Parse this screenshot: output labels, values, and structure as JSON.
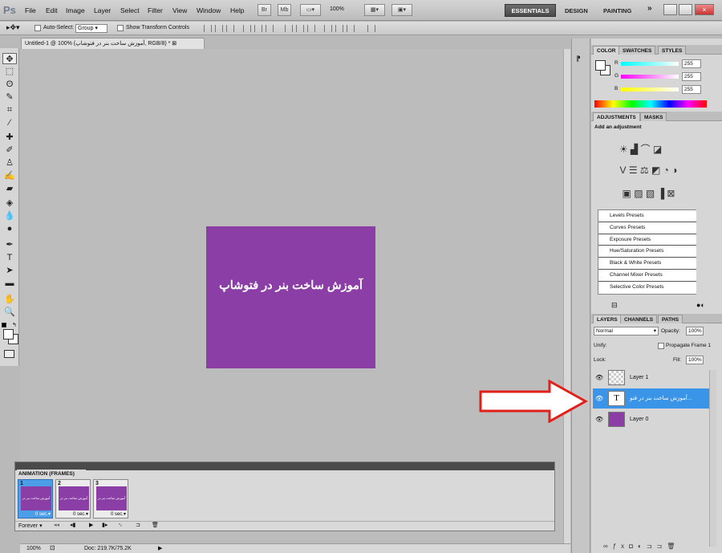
{
  "menubar": {
    "logo": "Ps",
    "items": [
      "File",
      "Edit",
      "Image",
      "Layer",
      "Select",
      "Filter",
      "View",
      "Window",
      "Help"
    ],
    "zoom": "100%",
    "workspaces": [
      "ESSENTIALS",
      "DESIGN",
      "PAINTING"
    ],
    "more": "»"
  },
  "options": {
    "auto_select_label": "Auto-Select:",
    "auto_select_value": "Group",
    "show_transform_label": "Show Transform Controls"
  },
  "document": {
    "tab_title": "Untitled-1 @ 100% (آموزش ساخت بنر در فتوشاپ, RGB/8) *",
    "artwork_text": "آموزش ساخت بنر در فتوشاپ",
    "artwork_color": "#8b3fa6"
  },
  "status": {
    "zoom": "100%",
    "doc": "Doc: 219.7K/75.2K"
  },
  "animation": {
    "title": "ANIMATION (FRAMES)",
    "frames": [
      {
        "num": "1",
        "delay": "0 sec.▾",
        "thumb": "آموزش ساخت بنر در فتوشاپ"
      },
      {
        "num": "2",
        "delay": "0 sec.▾",
        "thumb": "آموزش ساخت بنر در فتوشاپ"
      },
      {
        "num": "3",
        "delay": "0 sec.▾",
        "thumb": "آموزش ساخت بنر در فتوشاپ"
      }
    ],
    "loop": "Forever"
  },
  "color_panel": {
    "tabs": [
      "COLOR",
      "SWATCHES",
      "STYLES"
    ],
    "r_label": "R",
    "g_label": "G",
    "b_label": "B",
    "r": "255",
    "g": "255",
    "b": "255"
  },
  "adjustments": {
    "tabs": [
      "ADJUSTMENTS",
      "MASKS"
    ],
    "hint": "Add an adjustment",
    "presets": [
      "Levels Presets",
      "Curves Presets",
      "Exposure Presets",
      "Hue/Saturation Presets",
      "Black & White Presets",
      "Channel Mixer Presets",
      "Selective Color Presets"
    ]
  },
  "layers": {
    "tabs": [
      "LAYERS",
      "CHANNELS",
      "PATHS"
    ],
    "blend_mode": "Normal",
    "opacity_label": "Opacity:",
    "opacity": "100%",
    "unify_label": "Unify:",
    "propagate_label": "Propagate Frame 1",
    "lock_label": "Lock:",
    "fill_label": "Fill:",
    "fill": "100%",
    "items": [
      {
        "name": "Layer 1",
        "type": "empty"
      },
      {
        "name": "...آموزش ساخت بنر در فتو",
        "type": "text",
        "thumb_glyph": "T"
      },
      {
        "name": "Layer 0",
        "type": "color"
      }
    ]
  }
}
